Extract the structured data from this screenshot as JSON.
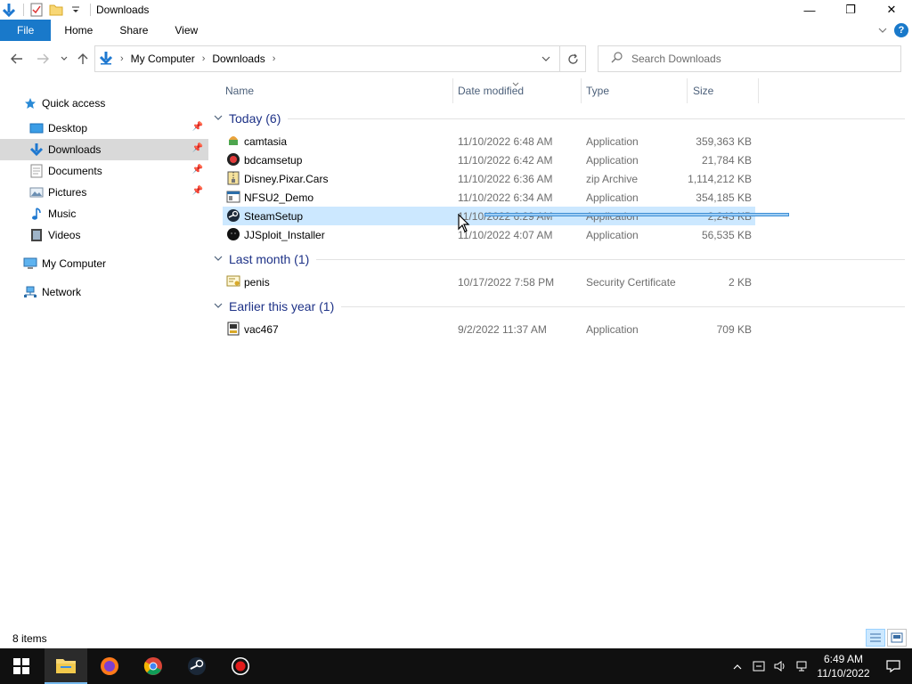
{
  "window": {
    "title": "Downloads",
    "controls": {
      "minimize": "—",
      "restore": "❐",
      "close": "✕"
    }
  },
  "ribbon": {
    "tabs": [
      {
        "label": "File"
      },
      {
        "label": "Home"
      },
      {
        "label": "Share"
      },
      {
        "label": "View"
      }
    ],
    "help": "?"
  },
  "address": {
    "crumbs": [
      "My Computer",
      "Downloads"
    ]
  },
  "search": {
    "placeholder": "Search Downloads"
  },
  "nav": {
    "items": [
      {
        "label": "Quick access",
        "icon": "star-icon",
        "level": 0
      },
      {
        "label": "Desktop",
        "icon": "desktop-folder-icon",
        "level": 1,
        "pinned": true
      },
      {
        "label": "Downloads",
        "icon": "downloads-folder-icon",
        "level": 1,
        "pinned": true,
        "selected": true
      },
      {
        "label": "Documents",
        "icon": "documents-folder-icon",
        "level": 1,
        "pinned": true
      },
      {
        "label": "Pictures",
        "icon": "pictures-folder-icon",
        "level": 1,
        "pinned": true
      },
      {
        "label": "Music",
        "icon": "music-folder-icon",
        "level": 1
      },
      {
        "label": "Videos",
        "icon": "videos-folder-icon",
        "level": 1
      },
      {
        "label": "My Computer",
        "icon": "computer-icon",
        "level": 0
      },
      {
        "label": "Network",
        "icon": "network-icon",
        "level": 0
      }
    ]
  },
  "columns": {
    "name": "Name",
    "date": "Date modified",
    "type": "Type",
    "size": "Size"
  },
  "groups": [
    {
      "title": "Today (6)",
      "files": [
        {
          "name": "camtasia",
          "date": "11/10/2022 6:48 AM",
          "type": "Application",
          "size": "359,363 KB",
          "icon": "camtasia-icon"
        },
        {
          "name": "bdcamsetup",
          "date": "11/10/2022 6:42 AM",
          "type": "Application",
          "size": "21,784 KB",
          "icon": "bandicam-icon"
        },
        {
          "name": "Disney.Pixar.Cars",
          "date": "11/10/2022 6:36 AM",
          "type": "zip Archive",
          "size": "1,114,212 KB",
          "icon": "zip-archive-icon"
        },
        {
          "name": "NFSU2_Demo",
          "date": "11/10/2022 6:34 AM",
          "type": "Application",
          "size": "354,185 KB",
          "icon": "application-window-icon"
        },
        {
          "name": "SteamSetup",
          "date": "11/10/2022 6:29 AM",
          "type": "Application",
          "size": "2,243 KB",
          "icon": "steam-icon",
          "selected": true
        },
        {
          "name": "JJSploit_Installer",
          "date": "11/10/2022 4:07 AM",
          "type": "Application",
          "size": "56,535 KB",
          "icon": "jjsploit-icon"
        }
      ]
    },
    {
      "title": "Last month (1)",
      "files": [
        {
          "name": "penis",
          "date": "10/17/2022 7:58 PM",
          "type": "Security Certificate",
          "size": "2 KB",
          "icon": "certificate-icon"
        }
      ]
    },
    {
      "title": "Earlier this year (1)",
      "files": [
        {
          "name": "vac467",
          "date": "9/2/2022 11:37 AM",
          "type": "Application",
          "size": "709 KB",
          "icon": "installer-icon"
        }
      ]
    }
  ],
  "status": {
    "items": "8 items"
  },
  "taskbar": {
    "apps": [
      "start-icon",
      "file-explorer-icon",
      "firefox-icon",
      "chrome-icon",
      "steam-icon",
      "recorder-icon"
    ],
    "clock": {
      "time": "6:49 AM",
      "date": "11/10/2022"
    }
  }
}
